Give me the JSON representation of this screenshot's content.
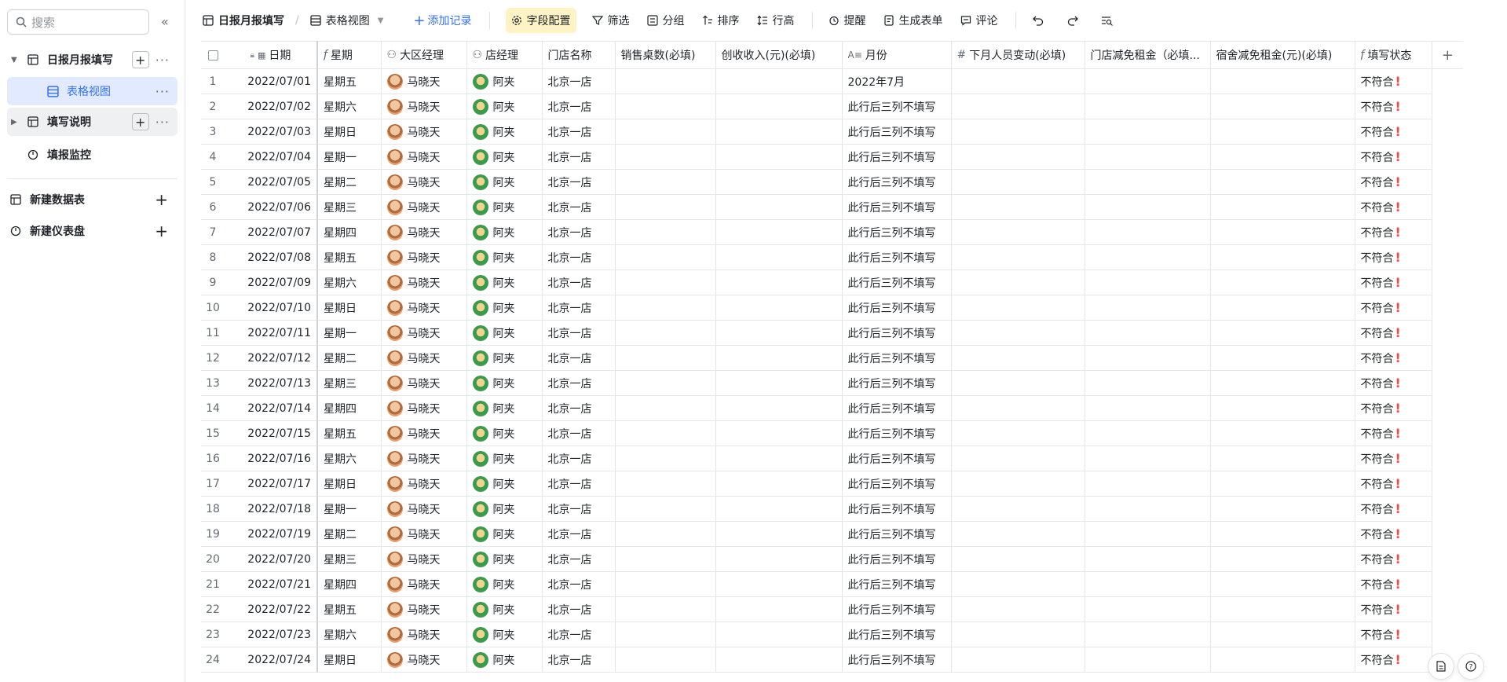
{
  "sidebar": {
    "search_placeholder": "搜索",
    "items": [
      {
        "label": "日报月报填写"
      },
      {
        "label": "表格视图"
      },
      {
        "label": "填写说明"
      },
      {
        "label": "填报监控"
      },
      {
        "label": "新建数据表"
      },
      {
        "label": "新建仪表盘"
      }
    ]
  },
  "toolbar": {
    "table_name": "日报月报填写",
    "view_name": "表格视图",
    "add_record": "添加记录",
    "field_config": "字段配置",
    "filter": "筛选",
    "group": "分组",
    "sort": "排序",
    "row_height": "行高",
    "reminder": "提醒",
    "gen_form": "生成表单",
    "comment": "评论"
  },
  "columns": [
    "日期",
    "星期",
    "大区经理",
    "店经理",
    "门店名称",
    "销售桌数(必填)",
    "创收收入(元)(必填)",
    "月份",
    "下月人员变动(必填)",
    "门店减免租金（必填...",
    "宿舍减免租金(元)(必填)",
    "填写状态"
  ],
  "rows": [
    {
      "n": "1",
      "date": "2022/07/01",
      "week": "星期五",
      "mgr": "马晓天",
      "store_mgr": "阿夹",
      "store": "北京一店",
      "month": "2022年7月",
      "status": "不符合"
    },
    {
      "n": "2",
      "date": "2022/07/02",
      "week": "星期六",
      "mgr": "马晓天",
      "store_mgr": "阿夹",
      "store": "北京一店",
      "month": "此行后三列不填写",
      "status": "不符合"
    },
    {
      "n": "3",
      "date": "2022/07/03",
      "week": "星期日",
      "mgr": "马晓天",
      "store_mgr": "阿夹",
      "store": "北京一店",
      "month": "此行后三列不填写",
      "status": "不符合"
    },
    {
      "n": "4",
      "date": "2022/07/04",
      "week": "星期一",
      "mgr": "马晓天",
      "store_mgr": "阿夹",
      "store": "北京一店",
      "month": "此行后三列不填写",
      "status": "不符合"
    },
    {
      "n": "5",
      "date": "2022/07/05",
      "week": "星期二",
      "mgr": "马晓天",
      "store_mgr": "阿夹",
      "store": "北京一店",
      "month": "此行后三列不填写",
      "status": "不符合"
    },
    {
      "n": "6",
      "date": "2022/07/06",
      "week": "星期三",
      "mgr": "马晓天",
      "store_mgr": "阿夹",
      "store": "北京一店",
      "month": "此行后三列不填写",
      "status": "不符合"
    },
    {
      "n": "7",
      "date": "2022/07/07",
      "week": "星期四",
      "mgr": "马晓天",
      "store_mgr": "阿夹",
      "store": "北京一店",
      "month": "此行后三列不填写",
      "status": "不符合"
    },
    {
      "n": "8",
      "date": "2022/07/08",
      "week": "星期五",
      "mgr": "马晓天",
      "store_mgr": "阿夹",
      "store": "北京一店",
      "month": "此行后三列不填写",
      "status": "不符合"
    },
    {
      "n": "9",
      "date": "2022/07/09",
      "week": "星期六",
      "mgr": "马晓天",
      "store_mgr": "阿夹",
      "store": "北京一店",
      "month": "此行后三列不填写",
      "status": "不符合"
    },
    {
      "n": "10",
      "date": "2022/07/10",
      "week": "星期日",
      "mgr": "马晓天",
      "store_mgr": "阿夹",
      "store": "北京一店",
      "month": "此行后三列不填写",
      "status": "不符合"
    },
    {
      "n": "11",
      "date": "2022/07/11",
      "week": "星期一",
      "mgr": "马晓天",
      "store_mgr": "阿夹",
      "store": "北京一店",
      "month": "此行后三列不填写",
      "status": "不符合"
    },
    {
      "n": "12",
      "date": "2022/07/12",
      "week": "星期二",
      "mgr": "马晓天",
      "store_mgr": "阿夹",
      "store": "北京一店",
      "month": "此行后三列不填写",
      "status": "不符合"
    },
    {
      "n": "13",
      "date": "2022/07/13",
      "week": "星期三",
      "mgr": "马晓天",
      "store_mgr": "阿夹",
      "store": "北京一店",
      "month": "此行后三列不填写",
      "status": "不符合"
    },
    {
      "n": "14",
      "date": "2022/07/14",
      "week": "星期四",
      "mgr": "马晓天",
      "store_mgr": "阿夹",
      "store": "北京一店",
      "month": "此行后三列不填写",
      "status": "不符合"
    },
    {
      "n": "15",
      "date": "2022/07/15",
      "week": "星期五",
      "mgr": "马晓天",
      "store_mgr": "阿夹",
      "store": "北京一店",
      "month": "此行后三列不填写",
      "status": "不符合"
    },
    {
      "n": "16",
      "date": "2022/07/16",
      "week": "星期六",
      "mgr": "马晓天",
      "store_mgr": "阿夹",
      "store": "北京一店",
      "month": "此行后三列不填写",
      "status": "不符合"
    },
    {
      "n": "17",
      "date": "2022/07/17",
      "week": "星期日",
      "mgr": "马晓天",
      "store_mgr": "阿夹",
      "store": "北京一店",
      "month": "此行后三列不填写",
      "status": "不符合"
    },
    {
      "n": "18",
      "date": "2022/07/18",
      "week": "星期一",
      "mgr": "马晓天",
      "store_mgr": "阿夹",
      "store": "北京一店",
      "month": "此行后三列不填写",
      "status": "不符合"
    },
    {
      "n": "19",
      "date": "2022/07/19",
      "week": "星期二",
      "mgr": "马晓天",
      "store_mgr": "阿夹",
      "store": "北京一店",
      "month": "此行后三列不填写",
      "status": "不符合"
    },
    {
      "n": "20",
      "date": "2022/07/20",
      "week": "星期三",
      "mgr": "马晓天",
      "store_mgr": "阿夹",
      "store": "北京一店",
      "month": "此行后三列不填写",
      "status": "不符合"
    },
    {
      "n": "21",
      "date": "2022/07/21",
      "week": "星期四",
      "mgr": "马晓天",
      "store_mgr": "阿夹",
      "store": "北京一店",
      "month": "此行后三列不填写",
      "status": "不符合"
    },
    {
      "n": "22",
      "date": "2022/07/22",
      "week": "星期五",
      "mgr": "马晓天",
      "store_mgr": "阿夹",
      "store": "北京一店",
      "month": "此行后三列不填写",
      "status": "不符合"
    },
    {
      "n": "23",
      "date": "2022/07/23",
      "week": "星期六",
      "mgr": "马晓天",
      "store_mgr": "阿夹",
      "store": "北京一店",
      "month": "此行后三列不填写",
      "status": "不符合"
    },
    {
      "n": "24",
      "date": "2022/07/24",
      "week": "星期日",
      "mgr": "马晓天",
      "store_mgr": "阿夹",
      "store": "北京一店",
      "month": "此行后三列不填写",
      "status": "不符合"
    }
  ],
  "colors": {
    "accent": "#3370ff",
    "selected_bg": "#e1eaff",
    "highlight": "#fef3c5",
    "warn": "#f54a45"
  }
}
